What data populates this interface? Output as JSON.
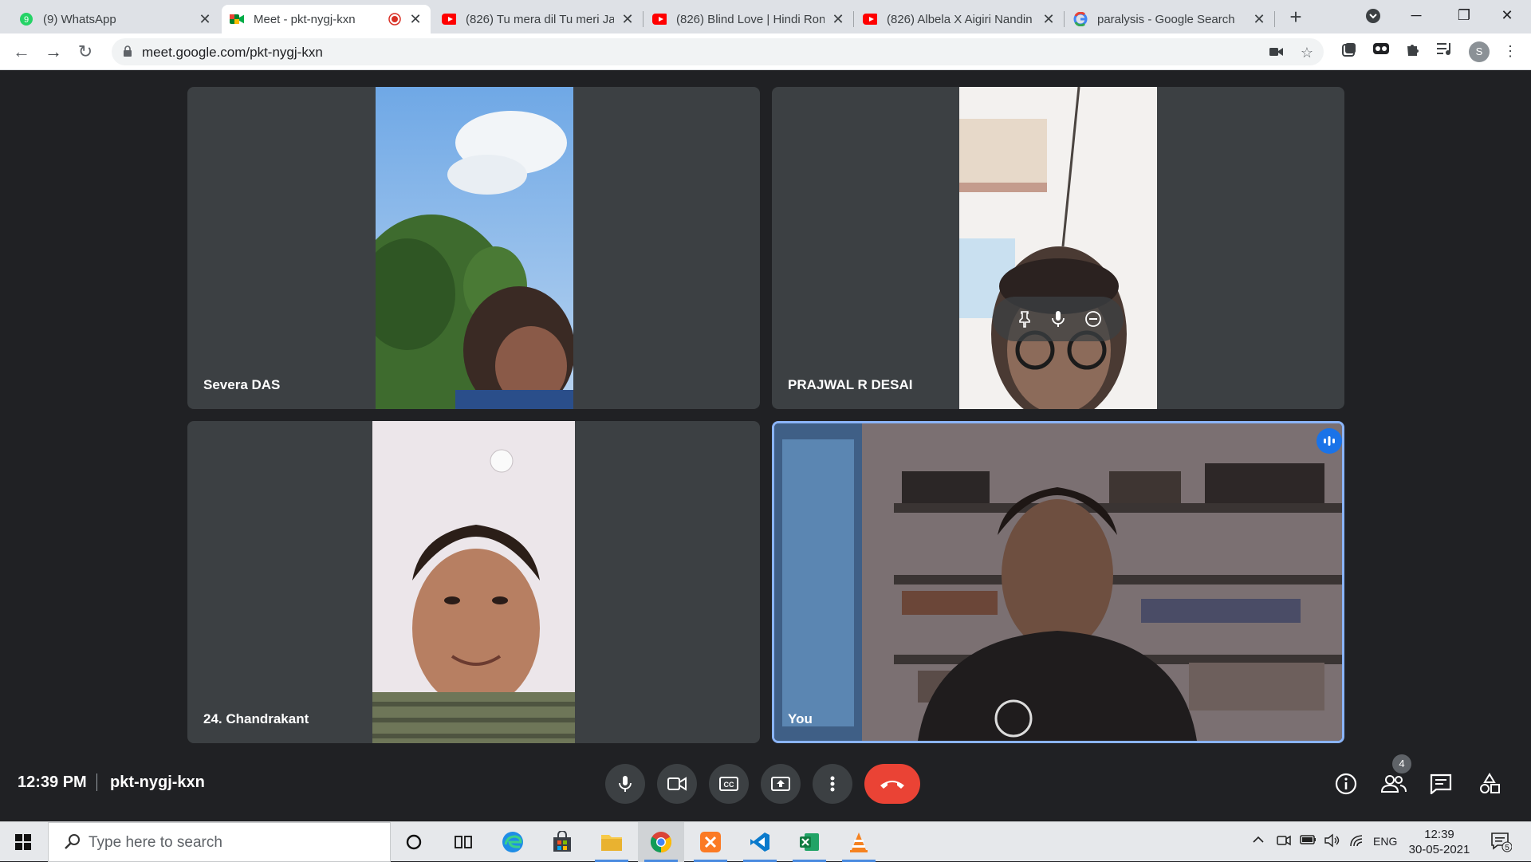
{
  "browser": {
    "tabs": [
      {
        "title": "(9) WhatsApp",
        "icon": "whatsapp-icon",
        "badge": "9"
      },
      {
        "title": "Meet - pkt-nygj-kxn",
        "icon": "google-meet-icon",
        "active": true
      },
      {
        "title": "(826) Tu mera dil Tu meri Ja",
        "icon": "youtube-icon"
      },
      {
        "title": "(826) Blind Love | Hindi Ron",
        "icon": "youtube-icon"
      },
      {
        "title": "(826) Albela X Aigiri Nandin",
        "icon": "youtube-icon"
      },
      {
        "title": "paralysis - Google Search",
        "icon": "google-icon"
      }
    ],
    "url": "meet.google.com/pkt-nygj-kxn",
    "profile_initial": "S"
  },
  "meet": {
    "participants": [
      {
        "name": "Severa DAS"
      },
      {
        "name": "PRAJWAL R DESAI"
      },
      {
        "name": "24. Chandrakant"
      },
      {
        "name": "You",
        "speaking": true
      }
    ],
    "time": "12:39 PM",
    "meeting_code": "pkt-nygj-kxn",
    "people_count": "4",
    "colors": {
      "end_call": "#ea4335",
      "speaking_border": "#8ab4f8",
      "tile": "#3c4043"
    }
  },
  "taskbar": {
    "search_placeholder": "Type here to search",
    "language": "ENG",
    "time": "12:39",
    "date": "30-05-2021",
    "notifications": "5"
  }
}
